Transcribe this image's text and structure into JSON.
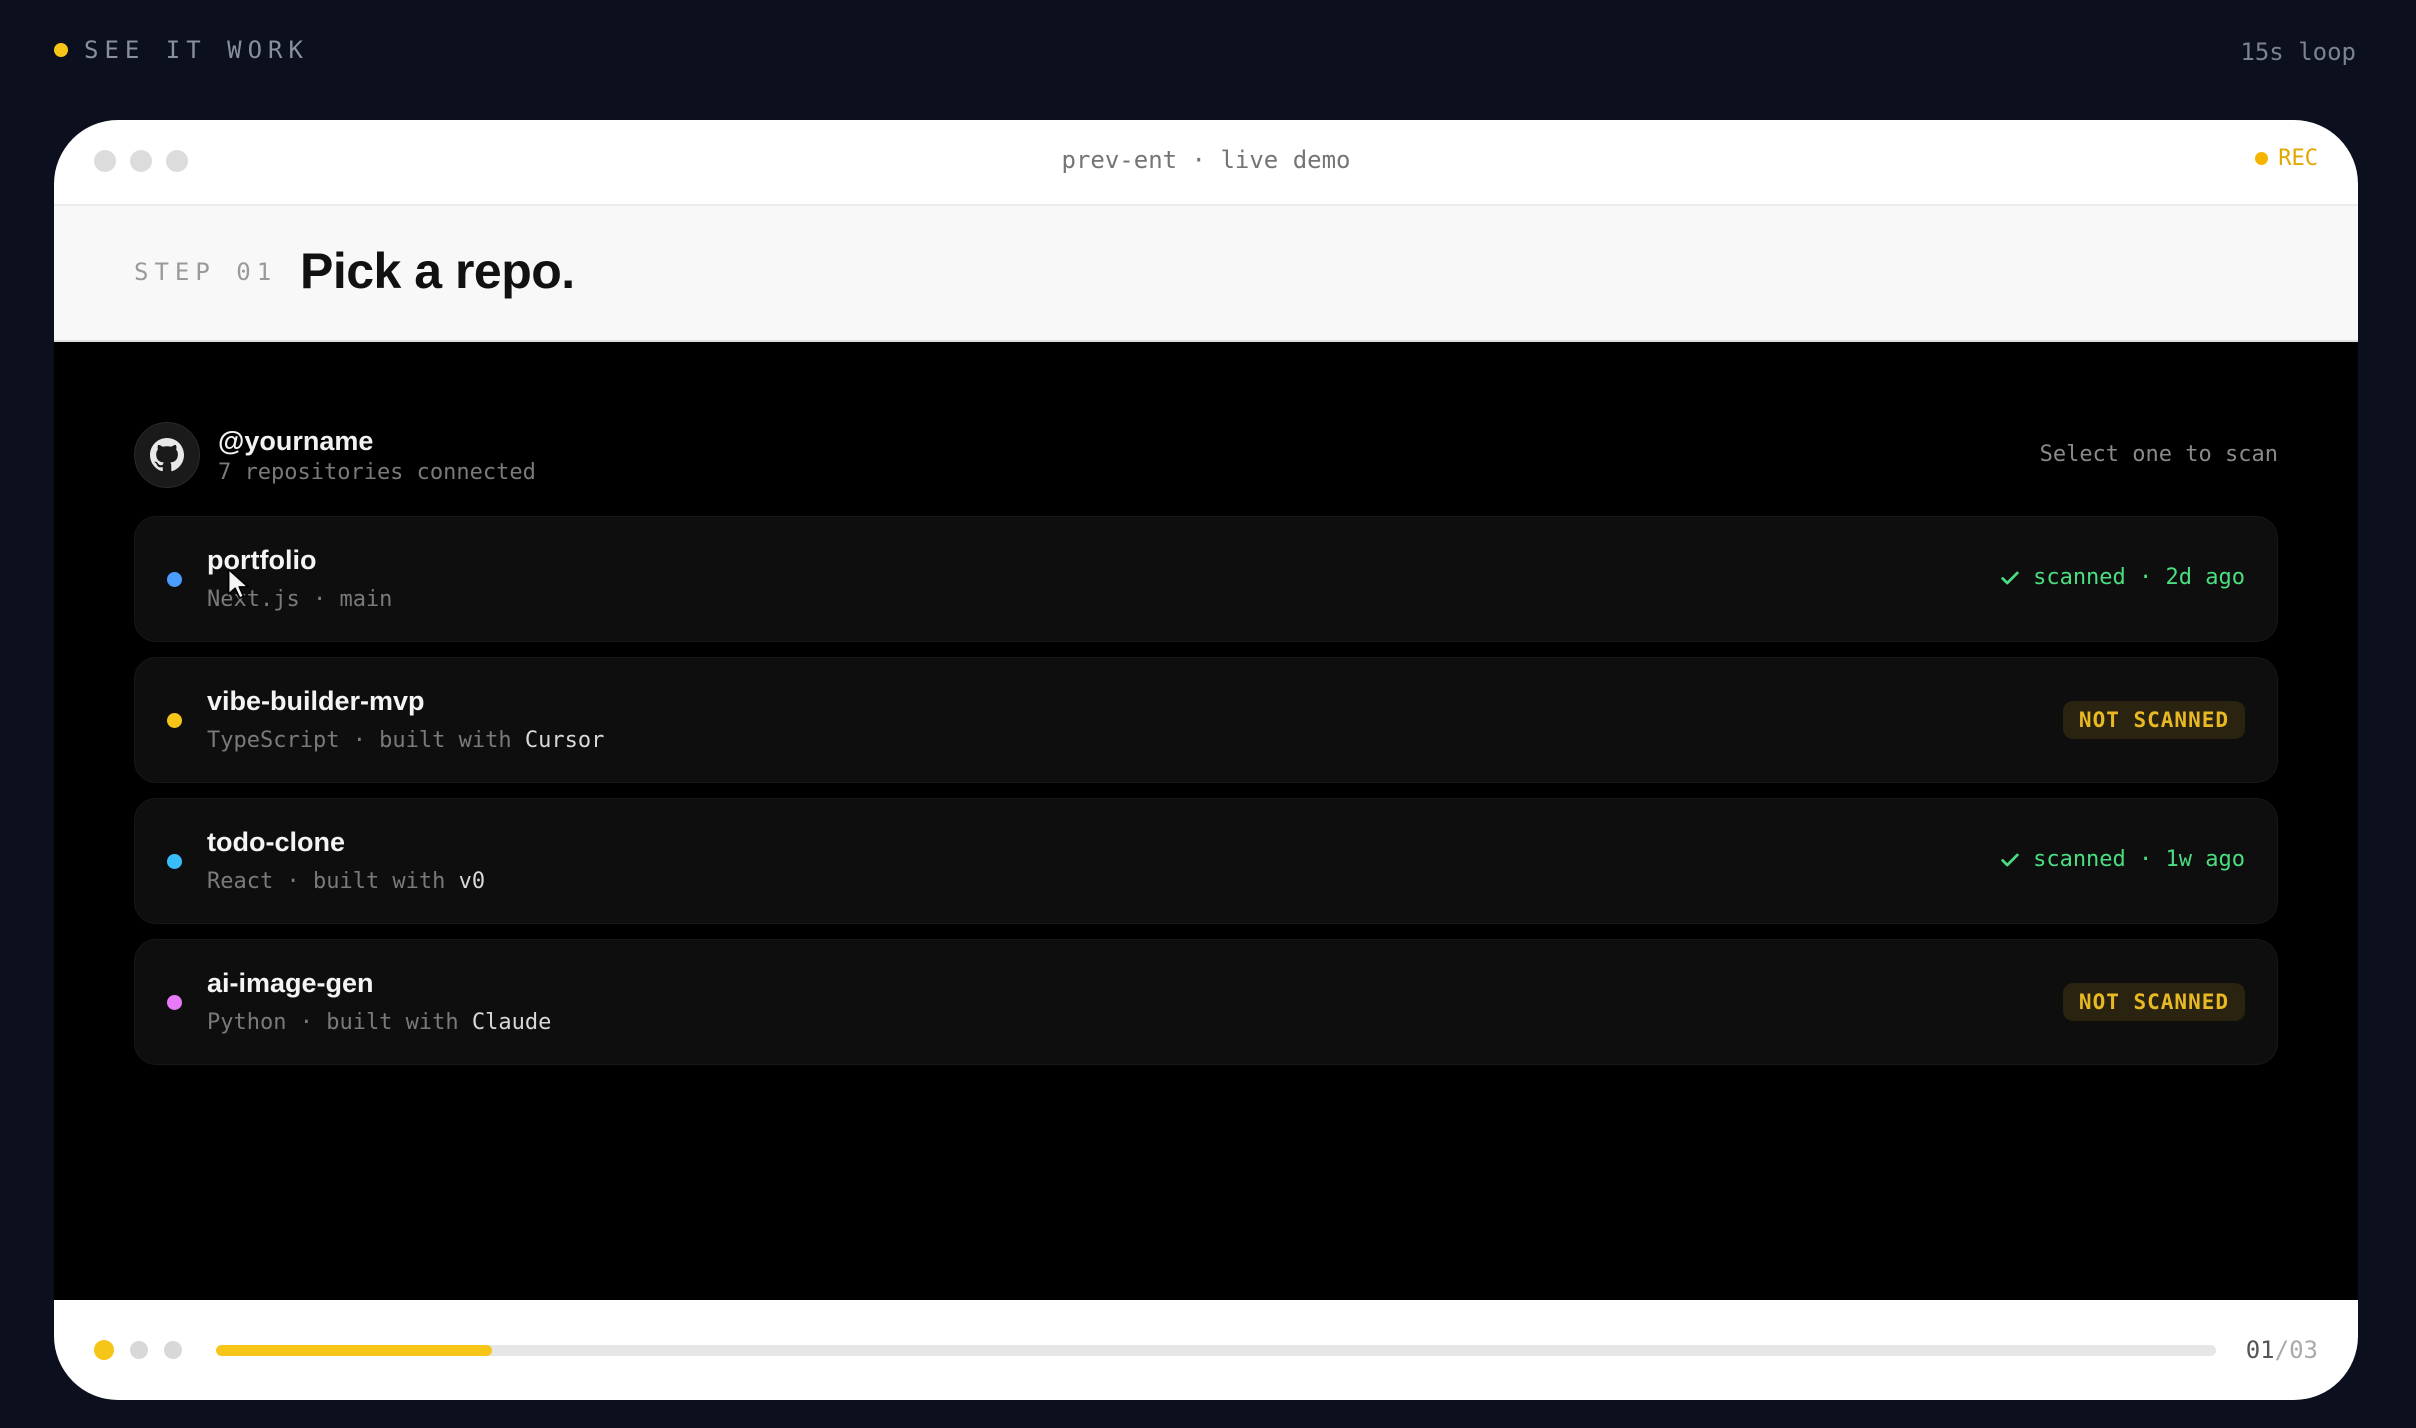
{
  "header": {
    "label": "SEE IT WORK",
    "loop": "15s loop"
  },
  "window": {
    "title": "prev-ent · live demo",
    "rec": "REC"
  },
  "step": {
    "label": "STEP 01",
    "title": "Pick a repo."
  },
  "account": {
    "name": "@yourname",
    "subtitle": "7 repositories connected",
    "hint": "Select one to scan"
  },
  "repos": [
    {
      "name": "portfolio",
      "meta": "Next.js · main",
      "tool": "",
      "dot": "#4a9cff",
      "status": "scanned · 2d ago",
      "scanned": true
    },
    {
      "name": "vibe-builder-mvp",
      "meta": "TypeScript · built with ",
      "tool": "Cursor",
      "dot": "#f5c518",
      "status": "NOT SCANNED",
      "scanned": false
    },
    {
      "name": "todo-clone",
      "meta": "React · built with ",
      "tool": "v0",
      "dot": "#38bdf8",
      "status": "scanned · 1w ago",
      "scanned": true
    },
    {
      "name": "ai-image-gen",
      "meta": "Python · built with ",
      "tool": "Claude",
      "dot": "#e879f9",
      "status": "NOT SCANNED",
      "scanned": false
    }
  ],
  "footer": {
    "current": "01",
    "separator": "/",
    "total": "03",
    "progress": 0.138
  },
  "colors": {
    "accent": "#f5c518",
    "success": "#4ade80",
    "warning_text": "#e8b923"
  },
  "icons": [
    "github-icon",
    "check-icon",
    "cursor-pointer-icon"
  ]
}
